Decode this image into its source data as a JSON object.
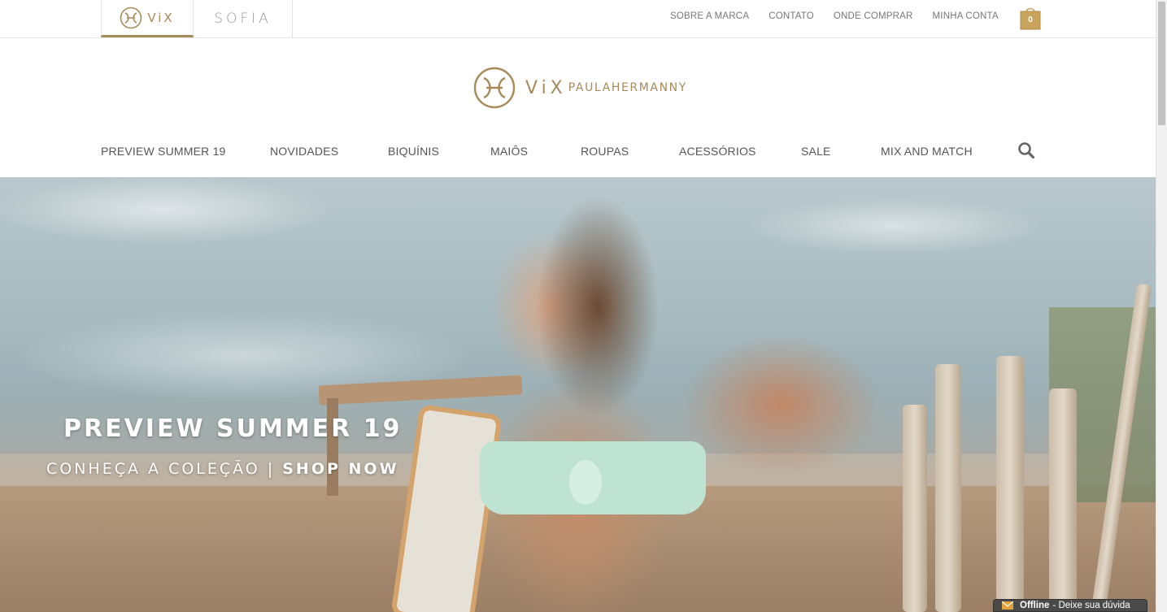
{
  "brand_tabs": [
    {
      "label": "ViX",
      "active": true
    },
    {
      "label": "SOFIA",
      "active": false
    }
  ],
  "utility_nav": [
    "SOBRE A MARCA",
    "CONTATO",
    "ONDE COMPRAR",
    "MINHA CONTA"
  ],
  "cart": {
    "count": "0"
  },
  "logo": {
    "mark": "ViX",
    "text": "PAULAHERMANNY"
  },
  "main_nav": [
    "PREVIEW SUMMER 19",
    "NOVIDADES",
    "BIQUÍNIS",
    "MAIÔS",
    "ROUPAS",
    "ACESSÓRIOS",
    "SALE",
    "MIX AND MATCH"
  ],
  "hero": {
    "title": "PREVIEW SUMMER 19",
    "subtitle_left": "CONHEÇA A COLEÇÃO | ",
    "subtitle_cta": "SHOP NOW"
  },
  "chat": {
    "status": "Offline",
    "message": "- Deixe sua dúvida"
  },
  "colors": {
    "brand_gold": "#a88a5a",
    "nav_text": "#555555"
  }
}
